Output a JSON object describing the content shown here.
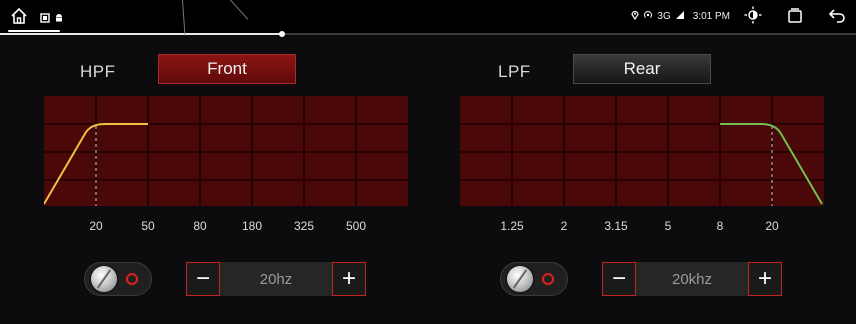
{
  "status_bar": {
    "time": "3:01 PM",
    "network": "3G",
    "icons": [
      "home-icon",
      "notification-icon",
      "android-icon",
      "location-icon",
      "hotspot-icon",
      "signal-icon",
      "brightness-icon",
      "recent-apps-icon",
      "back-icon"
    ],
    "progress": 0.33
  },
  "hpf": {
    "title": "HPF",
    "channel": "Front",
    "ticks": [
      "20",
      "50",
      "80",
      "180",
      "325",
      "500"
    ],
    "cutoff_label": "20",
    "value": "20hz",
    "curve_color": "#f0c040"
  },
  "lpf": {
    "title": "LPF",
    "channel": "Rear",
    "ticks": [
      "1.25",
      "2",
      "3.15",
      "5",
      "8",
      "20"
    ],
    "cutoff_label": "20",
    "value": "20khz",
    "curve_color": "#70c050"
  },
  "stepper": {
    "minus": "−",
    "plus": "+"
  },
  "colors": {
    "graph_bg": "#4b0808",
    "grid": "#1c0000",
    "accent": "#c22222"
  }
}
